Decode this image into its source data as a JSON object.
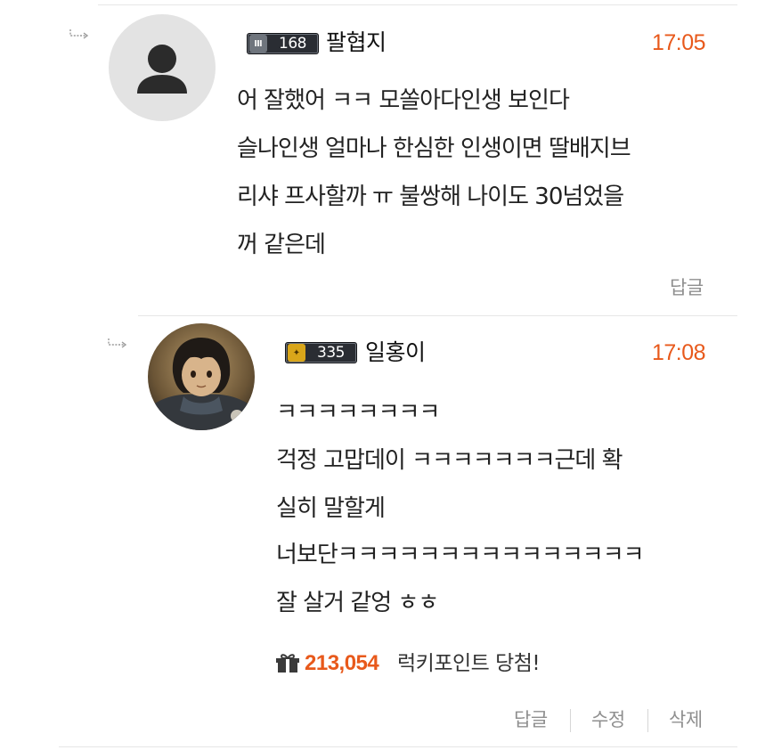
{
  "comments": [
    {
      "level": "168",
      "nickname": "팔협지",
      "time": "17:05",
      "lines": [
        "어 잘했어 ㅋㅋ 모쏠아다인생 보인다",
        "슬나인생 얼마나 한심한 인생이면 딸배지브",
        "리샤 프사할까 ㅠ 불쌍해 나이도 30넘었을",
        "꺼 같은데"
      ],
      "reply_label": "답글"
    },
    {
      "level": "335",
      "nickname": "일홍이",
      "time": "17:08",
      "lines": [
        "ㅋㅋㅋㅋㅋㅋㅋㅋ",
        "걱정 고맙데이 ㅋㅋㅋㅋㅋㅋㅋ근데 확",
        "실히 말할게",
        "너보단ㅋㅋㅋㅋㅋㅋㅋㅋㅋㅋㅋㅋㅋㅋㅋ",
        "잘 살거 같엉 ㅎㅎ"
      ],
      "points_value": "213,054",
      "points_text": "럭키포인트 당첨!",
      "reply_label": "답글",
      "edit_label": "수정",
      "delete_label": "삭제"
    }
  ],
  "colors": {
    "accent": "#e8591b",
    "text": "#222222",
    "muted": "#8f8f8f",
    "divider": "#e6e6e6"
  },
  "icons": [
    "reply-arrow-icon",
    "default-user-icon",
    "gift-icon"
  ]
}
